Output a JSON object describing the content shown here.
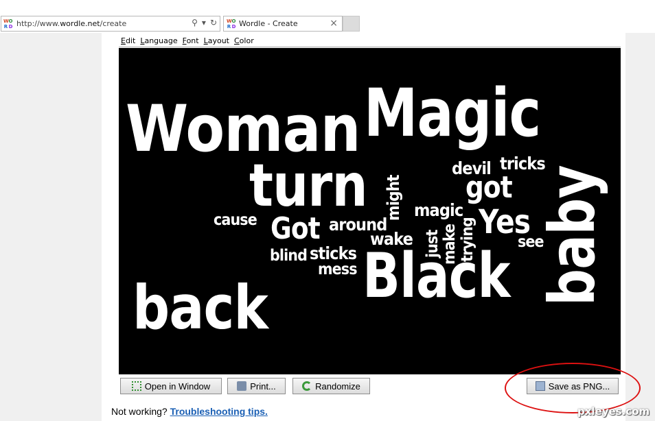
{
  "browser": {
    "url_prefix": "http://www.",
    "url_domain": "wordle.net",
    "url_path": "/create",
    "tab_title": "Wordle - Create",
    "favicon": [
      "W",
      "O",
      "R",
      "D",
      "L",
      "E"
    ]
  },
  "menu": [
    "Edit",
    "Language",
    "Font",
    "Layout",
    "Color"
  ],
  "cloud_words": [
    "Woman",
    "Magic",
    "turn",
    "baby",
    "back",
    "Black",
    "Yes",
    "got",
    "Got",
    "tricks",
    "devil",
    "might",
    "magic",
    "cause",
    "around",
    "wake",
    "just",
    "make",
    "trying",
    "see",
    "sticks",
    "blind",
    "mess"
  ],
  "buttons": {
    "open": "Open in Window",
    "print": "Print...",
    "randomize": "Randomize",
    "save": "Save as PNG..."
  },
  "footer": {
    "prefix": "Not working?",
    "link": "Troubleshooting tips."
  },
  "watermark": "pxleyes.com"
}
